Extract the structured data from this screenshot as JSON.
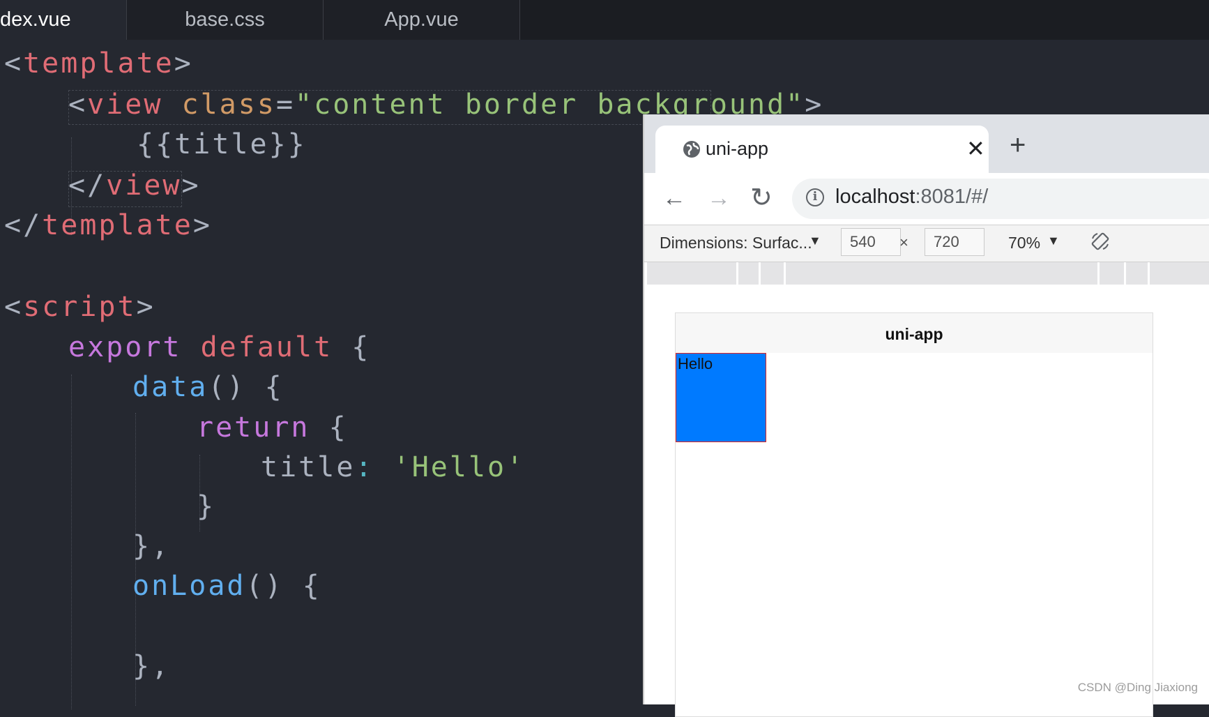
{
  "editor": {
    "tabs": [
      {
        "label": "dex.vue",
        "active": true
      },
      {
        "label": "base.css",
        "active": false
      },
      {
        "label": "App.vue",
        "active": false
      }
    ],
    "code": {
      "l1": {
        "open": "<",
        "tag": "template",
        "close": ">"
      },
      "l2": {
        "open": "<",
        "tag": "view",
        "attr": "class",
        "eq": "=",
        "value": "\"content border background\"",
        "close": ">"
      },
      "l3": {
        "text": "{{title}}"
      },
      "l4": {
        "open": "</",
        "tag": "view",
        "close": ">"
      },
      "l5": {
        "open": "</",
        "tag": "template",
        "close": ">"
      },
      "l7": {
        "open": "<",
        "tag": "script",
        "close": ">"
      },
      "l8": {
        "kw": "export",
        "kw2": "default",
        "brace": "{"
      },
      "l9": {
        "fn": "data",
        "paren": "()",
        "brace": "{"
      },
      "l10": {
        "kw": "return",
        "brace": "{"
      },
      "l11": {
        "key": "title",
        "colon": ":",
        "str": "'Hello'"
      },
      "l12": {
        "brace": "}"
      },
      "l13": {
        "brace": "},"
      },
      "l14": {
        "fn": "onLoad",
        "paren": "()",
        "brace": "{"
      },
      "l16": {
        "brace": "},"
      }
    }
  },
  "browser": {
    "tab_title": "uni-app",
    "close_symbol": "✕",
    "new_tab_symbol": "+",
    "back_symbol": "←",
    "forward_symbol": "→",
    "reload_symbol": "↻",
    "url_host": "localhost",
    "url_rest": ":8081/#/",
    "devtools": {
      "dimensions_label": "Dimensions: Surfac...",
      "width": "540",
      "height": "720",
      "times": "×",
      "zoom": "70%",
      "dropdown_symbol": "▼"
    },
    "page": {
      "header_title": "uni-app",
      "content_text": "Hello",
      "box_color": "#007aff",
      "border_color": "#e8231e"
    }
  },
  "watermark": "CSDN @Ding Jiaxiong"
}
